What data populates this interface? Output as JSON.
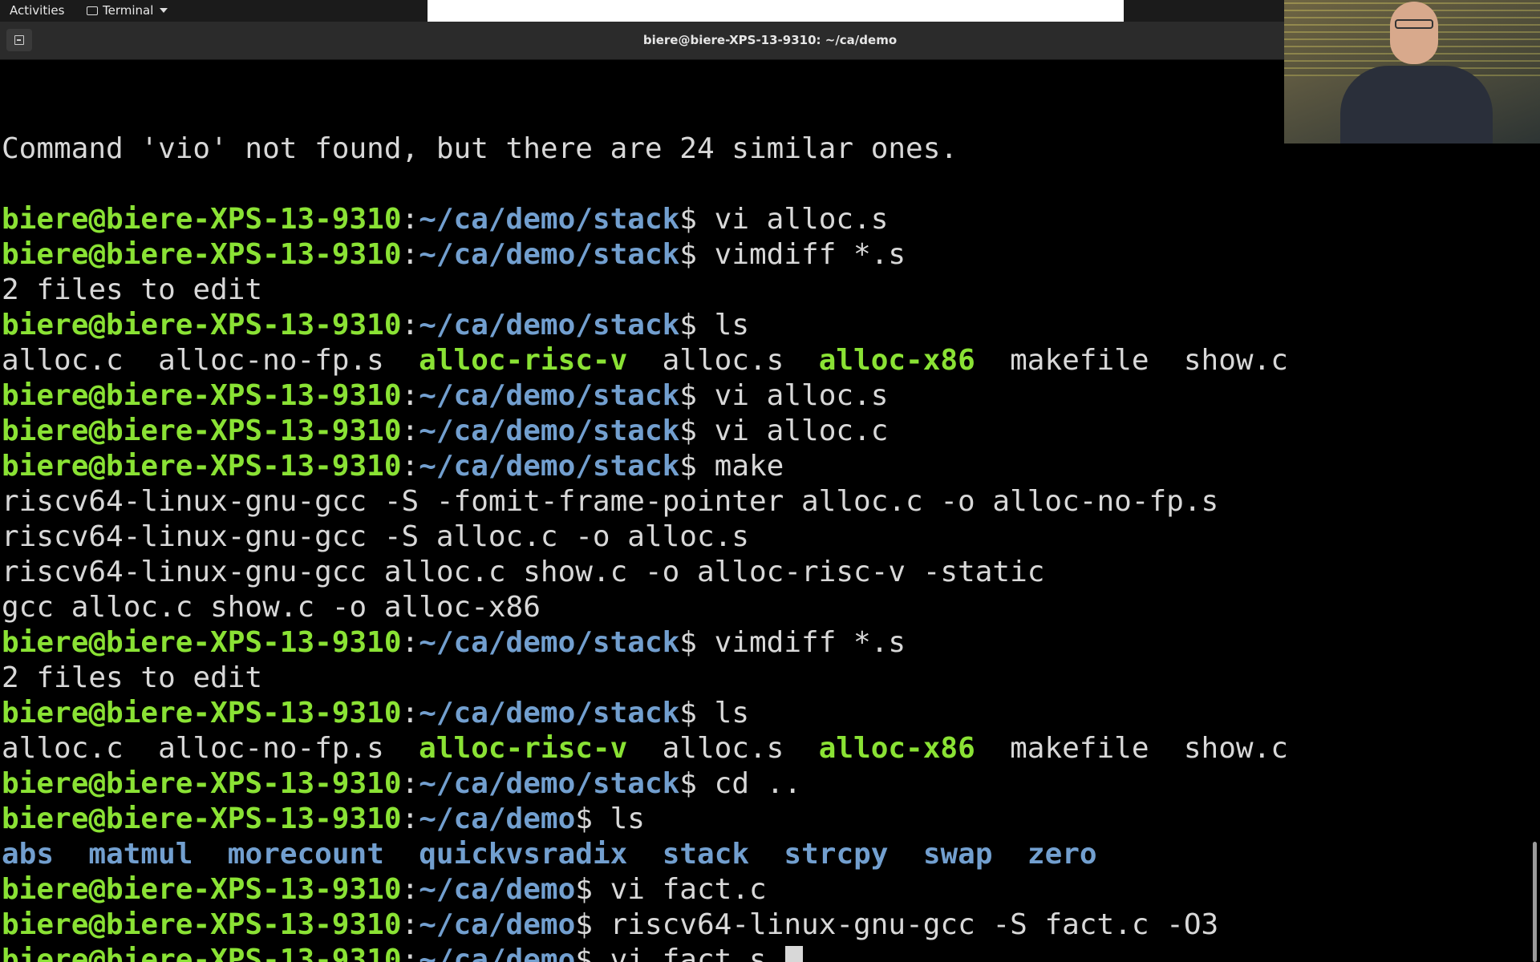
{
  "topbar": {
    "activities_label": "Activities",
    "app_label": "Terminal"
  },
  "window": {
    "title": "biere@biere-XPS-13-9310: ~/ca/demo"
  },
  "colors": {
    "user_host": "#8ae234",
    "path": "#729fcf",
    "text": "#d8d8d8",
    "background": "#000000"
  },
  "terminal": {
    "lines": [
      [
        {
          "t": "",
          "c": "plain"
        }
      ],
      [
        {
          "t": "Command 'vio' not found, but there are 24 similar ones.",
          "c": "plain"
        }
      ],
      [
        {
          "t": "",
          "c": "plain"
        }
      ],
      [
        {
          "t": "biere@biere-XPS-13-9310",
          "c": "user"
        },
        {
          "t": ":",
          "c": "plain"
        },
        {
          "t": "~/ca/demo/stack",
          "c": "path"
        },
        {
          "t": "$ vi alloc.s",
          "c": "plain"
        }
      ],
      [
        {
          "t": "biere@biere-XPS-13-9310",
          "c": "user"
        },
        {
          "t": ":",
          "c": "plain"
        },
        {
          "t": "~/ca/demo/stack",
          "c": "path"
        },
        {
          "t": "$ vimdiff *.s",
          "c": "plain"
        }
      ],
      [
        {
          "t": "2 files to edit",
          "c": "plain"
        }
      ],
      [
        {
          "t": "biere@biere-XPS-13-9310",
          "c": "user"
        },
        {
          "t": ":",
          "c": "plain"
        },
        {
          "t": "~/ca/demo/stack",
          "c": "path"
        },
        {
          "t": "$ ls",
          "c": "plain"
        }
      ],
      [
        {
          "t": "alloc.c  alloc-no-fp.s  ",
          "c": "plain"
        },
        {
          "t": "alloc-risc-v",
          "c": "exec"
        },
        {
          "t": "  alloc.s  ",
          "c": "plain"
        },
        {
          "t": "alloc-x86",
          "c": "exec"
        },
        {
          "t": "  makefile  show.c",
          "c": "plain"
        }
      ],
      [
        {
          "t": "biere@biere-XPS-13-9310",
          "c": "user"
        },
        {
          "t": ":",
          "c": "plain"
        },
        {
          "t": "~/ca/demo/stack",
          "c": "path"
        },
        {
          "t": "$ vi alloc.s",
          "c": "plain"
        }
      ],
      [
        {
          "t": "biere@biere-XPS-13-9310",
          "c": "user"
        },
        {
          "t": ":",
          "c": "plain"
        },
        {
          "t": "~/ca/demo/stack",
          "c": "path"
        },
        {
          "t": "$ vi alloc.c",
          "c": "plain"
        }
      ],
      [
        {
          "t": "biere@biere-XPS-13-9310",
          "c": "user"
        },
        {
          "t": ":",
          "c": "plain"
        },
        {
          "t": "~/ca/demo/stack",
          "c": "path"
        },
        {
          "t": "$ make",
          "c": "plain"
        }
      ],
      [
        {
          "t": "riscv64-linux-gnu-gcc -S -fomit-frame-pointer alloc.c -o alloc-no-fp.s",
          "c": "plain"
        }
      ],
      [
        {
          "t": "riscv64-linux-gnu-gcc -S alloc.c -o alloc.s",
          "c": "plain"
        }
      ],
      [
        {
          "t": "riscv64-linux-gnu-gcc alloc.c show.c -o alloc-risc-v -static",
          "c": "plain"
        }
      ],
      [
        {
          "t": "gcc alloc.c show.c -o alloc-x86",
          "c": "plain"
        }
      ],
      [
        {
          "t": "biere@biere-XPS-13-9310",
          "c": "user"
        },
        {
          "t": ":",
          "c": "plain"
        },
        {
          "t": "~/ca/demo/stack",
          "c": "path"
        },
        {
          "t": "$ vimdiff *.s",
          "c": "plain"
        }
      ],
      [
        {
          "t": "2 files to edit",
          "c": "plain"
        }
      ],
      [
        {
          "t": "biere@biere-XPS-13-9310",
          "c": "user"
        },
        {
          "t": ":",
          "c": "plain"
        },
        {
          "t": "~/ca/demo/stack",
          "c": "path"
        },
        {
          "t": "$ ls",
          "c": "plain"
        }
      ],
      [
        {
          "t": "alloc.c  alloc-no-fp.s  ",
          "c": "plain"
        },
        {
          "t": "alloc-risc-v",
          "c": "exec"
        },
        {
          "t": "  alloc.s  ",
          "c": "plain"
        },
        {
          "t": "alloc-x86",
          "c": "exec"
        },
        {
          "t": "  makefile  show.c",
          "c": "plain"
        }
      ],
      [
        {
          "t": "biere@biere-XPS-13-9310",
          "c": "user"
        },
        {
          "t": ":",
          "c": "plain"
        },
        {
          "t": "~/ca/demo/stack",
          "c": "path"
        },
        {
          "t": "$ cd ..",
          "c": "plain"
        }
      ],
      [
        {
          "t": "biere@biere-XPS-13-9310",
          "c": "user"
        },
        {
          "t": ":",
          "c": "plain"
        },
        {
          "t": "~/ca/demo",
          "c": "path"
        },
        {
          "t": "$ ls",
          "c": "plain"
        }
      ],
      [
        {
          "t": "abs",
          "c": "dir"
        },
        {
          "t": "  ",
          "c": "plain"
        },
        {
          "t": "matmul",
          "c": "dir"
        },
        {
          "t": "  ",
          "c": "plain"
        },
        {
          "t": "morecount",
          "c": "dir"
        },
        {
          "t": "  ",
          "c": "plain"
        },
        {
          "t": "quickvsradix",
          "c": "dir"
        },
        {
          "t": "  ",
          "c": "plain"
        },
        {
          "t": "stack",
          "c": "dir"
        },
        {
          "t": "  ",
          "c": "plain"
        },
        {
          "t": "strcpy",
          "c": "dir"
        },
        {
          "t": "  ",
          "c": "plain"
        },
        {
          "t": "swap",
          "c": "dir"
        },
        {
          "t": "  ",
          "c": "plain"
        },
        {
          "t": "zero",
          "c": "dir"
        }
      ],
      [
        {
          "t": "biere@biere-XPS-13-9310",
          "c": "user"
        },
        {
          "t": ":",
          "c": "plain"
        },
        {
          "t": "~/ca/demo",
          "c": "path"
        },
        {
          "t": "$ vi fact.c",
          "c": "plain"
        }
      ],
      [
        {
          "t": "biere@biere-XPS-13-9310",
          "c": "user"
        },
        {
          "t": ":",
          "c": "plain"
        },
        {
          "t": "~/ca/demo",
          "c": "path"
        },
        {
          "t": "$ riscv64-linux-gnu-gcc -S fact.c -O3",
          "c": "plain"
        }
      ],
      [
        {
          "t": "biere@biere-XPS-13-9310",
          "c": "user"
        },
        {
          "t": ":",
          "c": "plain"
        },
        {
          "t": "~/ca/demo",
          "c": "path"
        },
        {
          "t": "$ vi fact.s ",
          "c": "plain"
        }
      ]
    ]
  }
}
